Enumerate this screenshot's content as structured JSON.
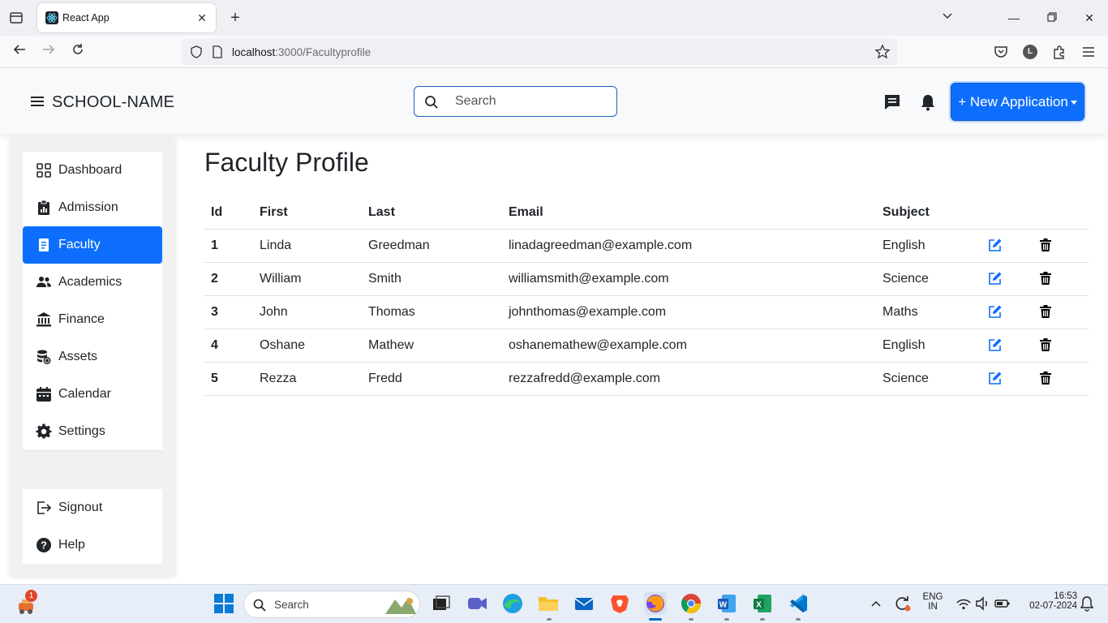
{
  "browser": {
    "tab_title": "React App",
    "url_host": "localhost",
    "url_path": ":3000/Facultyprofile",
    "profile_initial": "L"
  },
  "header": {
    "school_name": "SCHOOL-NAME",
    "search_placeholder": "Search",
    "new_application_label": "+ New Application"
  },
  "sidebar": {
    "items": [
      {
        "label": "Dashboard"
      },
      {
        "label": "Admission"
      },
      {
        "label": "Faculty"
      },
      {
        "label": "Academics"
      },
      {
        "label": "Finance"
      },
      {
        "label": "Assets"
      },
      {
        "label": "Calendar"
      },
      {
        "label": "Settings"
      }
    ],
    "bottom_items": [
      {
        "label": "Signout"
      },
      {
        "label": "Help"
      }
    ],
    "active": "Faculty"
  },
  "main": {
    "title": "Faculty Profile",
    "columns": [
      "Id",
      "First",
      "Last",
      "Email",
      "Subject"
    ],
    "rows": [
      {
        "id": "1",
        "first": "Linda",
        "last": "Greedman",
        "email": "linadagreedman@example.com",
        "subject": "English"
      },
      {
        "id": "2",
        "first": "William",
        "last": "Smith",
        "email": "williamsmith@example.com",
        "subject": "Science"
      },
      {
        "id": "3",
        "first": "John",
        "last": "Thomas",
        "email": "johnthomas@example.com",
        "subject": "Maths"
      },
      {
        "id": "4",
        "first": "Oshane",
        "last": "Mathew",
        "email": "oshanemathew@example.com",
        "subject": "English"
      },
      {
        "id": "5",
        "first": "Rezza",
        "last": "Fredd",
        "email": "rezzafredd@example.com",
        "subject": "Science"
      }
    ]
  },
  "taskbar": {
    "search_label": "Search",
    "notification_count": "1",
    "lang_line1": "ENG",
    "lang_line2": "IN",
    "time": "16:53",
    "date": "02-07-2024"
  },
  "colors": {
    "accent": "#0d6efd",
    "edit_icon": "#0d6efd",
    "delete_icon": "#000000"
  }
}
